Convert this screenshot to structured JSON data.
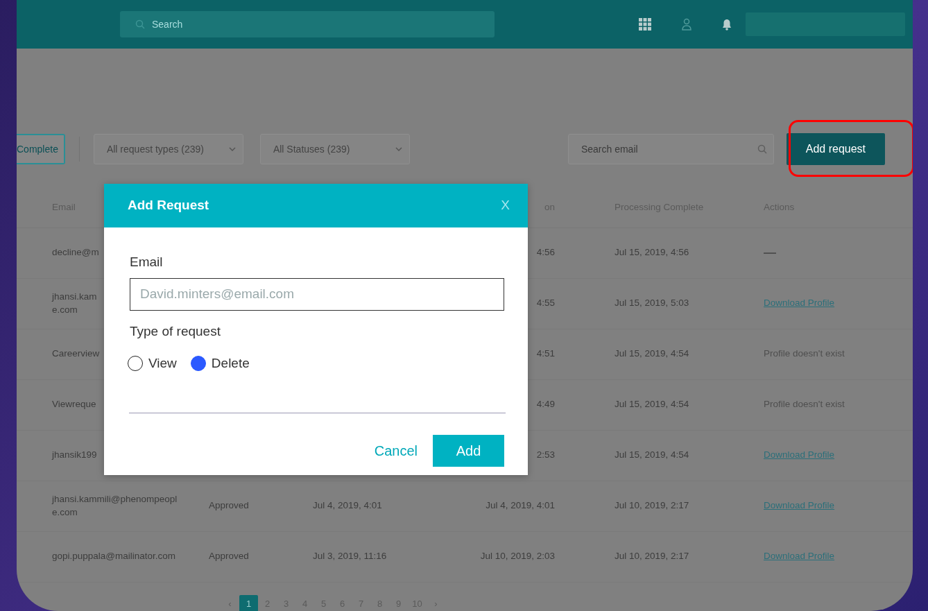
{
  "top_bar": {
    "search_placeholder": "Search"
  },
  "toolbar": {
    "filter_button": "Complete",
    "dropdowns": [
      "All request types (239)",
      "All Statuses (239)"
    ],
    "search_placeholder": "Search email",
    "add_button": "Add request",
    "add_button_highlighted": true
  },
  "table": {
    "columns": [
      "Email",
      null,
      null,
      "on",
      "Processing Complete",
      "Actions"
    ],
    "rows": [
      {
        "cells": [
          "decline@m",
          null,
          null,
          "4:56",
          "Jul 15, 2019, 4:56"
        ],
        "action": {
          "kind": "none",
          "text": "—"
        }
      },
      {
        "cells": [
          "jhansi.kam\ne.com",
          null,
          null,
          "4:55",
          "Jul 15, 2019, 5:03"
        ],
        "action": {
          "kind": "link",
          "text": "Download Profile"
        }
      },
      {
        "cells": [
          "Careerview",
          null,
          null,
          "4:51",
          "Jul 15, 2019, 4:54"
        ],
        "action": {
          "kind": "missing",
          "text": "Profile doesn't exist"
        }
      },
      {
        "cells": [
          "Viewreque",
          null,
          null,
          "4:49",
          "Jul 15, 2019, 4:54"
        ],
        "action": {
          "kind": "missing",
          "text": "Profile doesn't exist"
        }
      },
      {
        "cells": [
          "jhansik199",
          null,
          null,
          "2:53",
          "Jul 15, 2019, 4:54"
        ],
        "action": {
          "kind": "link",
          "text": "Download Profile"
        }
      },
      {
        "cells": [
          "jhansi.kammili@phenompeopl\ne.com",
          "Approved",
          "Jul 4, 2019, 4:01",
          "Jul 4, 2019, 4:01",
          "Jul 10, 2019, 2:17"
        ],
        "action": {
          "kind": "link",
          "text": "Download Profile"
        }
      },
      {
        "cells": [
          "gopi.puppala@mailinator.com",
          "Approved",
          "Jul 3, 2019, 11:16",
          "Jul 10, 2019, 2:03",
          "Jul 10, 2019, 2:17"
        ],
        "action": {
          "kind": "link",
          "text": "Download Profile"
        }
      }
    ]
  },
  "pagination": [
    {
      "label": "‹",
      "selected": false
    },
    {
      "label": "1",
      "selected": true
    },
    {
      "label": "2",
      "selected": false
    },
    {
      "label": "3",
      "selected": false
    },
    {
      "label": "4",
      "selected": false
    },
    {
      "label": "5",
      "selected": false
    },
    {
      "label": "6",
      "selected": false
    },
    {
      "label": "7",
      "selected": false
    },
    {
      "label": "8",
      "selected": false
    },
    {
      "label": "9",
      "selected": false
    },
    {
      "label": "10",
      "selected": false
    },
    {
      "label": "›",
      "selected": false
    }
  ],
  "modal": {
    "title": "Add Request",
    "close": "X",
    "email_label": "Email",
    "email_placeholder": "David.minters@email.com",
    "type_label": "Type of request",
    "options": [
      {
        "label": "View",
        "selected": false
      },
      {
        "label": "Delete",
        "selected": true
      }
    ],
    "cancel": "Cancel",
    "submit": "Add"
  }
}
